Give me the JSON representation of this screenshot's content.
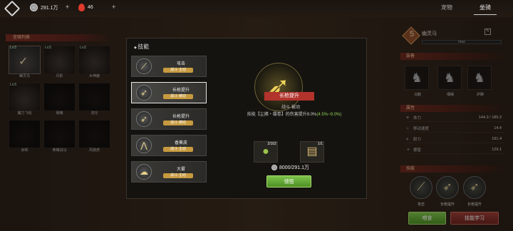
{
  "header": {
    "coins": "291.1万",
    "gems": "46",
    "tabs": [
      {
        "label": "宠物"
      },
      {
        "label": "坐骑"
      }
    ]
  },
  "left_panel": {
    "title": "坐骑列表",
    "mounts": [
      {
        "name": "幽灵马",
        "level": "Lv.5"
      },
      {
        "name": "月影",
        "level": "Lv.5"
      },
      {
        "name": "木神鹿",
        "level": "Lv.5"
      },
      {
        "name": "魔力飞毯",
        "level": "Lv.5"
      },
      {
        "name": "晨曦",
        "level": ""
      },
      {
        "name": "流光",
        "level": ""
      },
      {
        "name": "余晖",
        "level": ""
      },
      {
        "name": "荣耀战马",
        "level": ""
      },
      {
        "name": "风驰虎",
        "level": ""
      }
    ]
  },
  "right_panel": {
    "level": "5",
    "name": "幽灵马",
    "exp": "max",
    "equip_title": "装备",
    "equips": [
      {
        "label": "马鞍",
        "icon": "saddle-icon"
      },
      {
        "label": "缰绳",
        "icon": "rein-icon"
      },
      {
        "label": "护蹄",
        "icon": "hoof-icon"
      }
    ],
    "attr_title": "属性",
    "attrs": [
      {
        "label": "体力",
        "value": "144.3 / 185.3"
      },
      {
        "label": "移动速度",
        "value": "14.4"
      },
      {
        "label": "耐力",
        "value": "191.4"
      },
      {
        "label": "睿智",
        "value": "129.1"
      }
    ],
    "skill_title": "技能",
    "skills": [
      {
        "label": "攻击"
      },
      {
        "label": "长枪提升"
      },
      {
        "label": "长枪提升"
      }
    ],
    "feed_btn": "喂食",
    "learn_btn": "技能学习"
  },
  "modal": {
    "title": "技能",
    "list": [
      {
        "name": "攻击",
        "tag": "战斗·主动"
      },
      {
        "name": "长枪提升",
        "tag": "战斗·被动"
      },
      {
        "name": "长枪提升",
        "tag": "战斗·被动"
      },
      {
        "name": "香蕉皮",
        "tag": "战斗·主动"
      },
      {
        "name": "大雾",
        "tag": "战斗·主动"
      }
    ],
    "detail": {
      "name": "长枪提升",
      "type": "战斗·被动",
      "desc": "技能【尘拂・缨卷】的伤害提升9.0%",
      "desc_hl": "(4.5%~9.0%)",
      "materials": [
        {
          "count": "2/102"
        },
        {
          "count": "1/1"
        }
      ],
      "cost": "8000/291.1万",
      "learn_btn": "领悟"
    }
  }
}
